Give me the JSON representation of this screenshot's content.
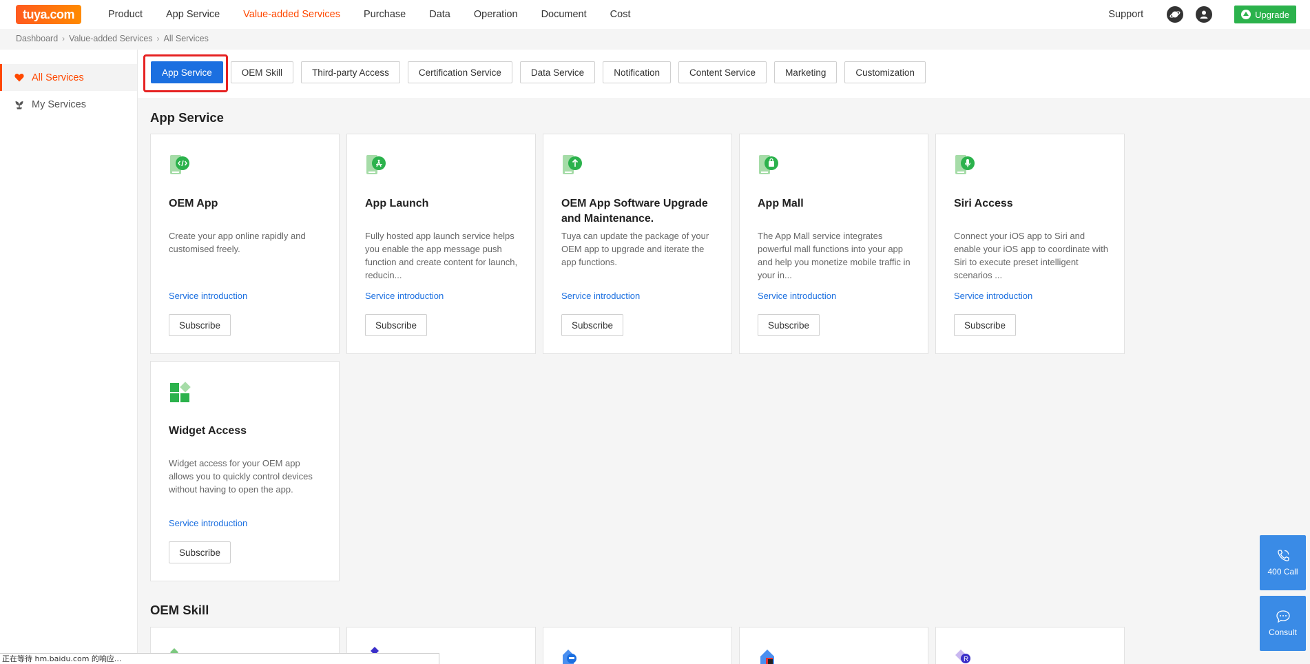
{
  "logo": {
    "text": "tuya.com"
  },
  "nav": {
    "items": [
      "Product",
      "App Service",
      "Value-added Services",
      "Purchase",
      "Data",
      "Operation",
      "Document",
      "Cost"
    ],
    "active_index": 2,
    "support": "Support",
    "upgrade": "Upgrade"
  },
  "breadcrumb": [
    "Dashboard",
    "Value-added Services",
    "All Services"
  ],
  "sidebar": {
    "items": [
      {
        "label": "All Services",
        "icon": "heart-icon"
      },
      {
        "label": "My Services",
        "icon": "plant-icon"
      }
    ]
  },
  "tabs": [
    "App Service",
    "OEM Skill",
    "Third-party Access",
    "Certification Service",
    "Data Service",
    "Notification",
    "Content Service",
    "Marketing",
    "Customization"
  ],
  "sections": [
    {
      "title": "App Service",
      "cards": [
        {
          "title": "OEM App",
          "desc": "Create your app online rapidly and customised freely.",
          "link": "Service introduction",
          "button": "Subscribe",
          "icon": "code-phone-icon"
        },
        {
          "title": "App Launch",
          "desc": "Fully hosted app launch service helps you enable the app message push function and create content for launch, reducin...",
          "link": "Service introduction",
          "button": "Subscribe",
          "icon": "app-store-phone-icon"
        },
        {
          "title": "OEM App Software Upgrade and Maintenance.",
          "desc": "Tuya can update the package of your OEM app to upgrade and iterate the app functions.",
          "link": "Service introduction",
          "button": "Subscribe",
          "icon": "upgrade-phone-icon"
        },
        {
          "title": "App Mall",
          "desc": "The App Mall service integrates powerful mall functions into your app and help you monetize mobile traffic in your in...",
          "link": "Service introduction",
          "button": "Subscribe",
          "icon": "mall-phone-icon"
        },
        {
          "title": "Siri Access",
          "desc": "Connect your iOS app to Siri and enable your iOS app to coordinate with Siri to execute preset intelligent scenarios ...",
          "link": "Service introduction",
          "button": "Subscribe",
          "icon": "microphone-phone-icon"
        },
        {
          "title": "Widget Access",
          "desc": "Widget access for your OEM app allows you to quickly control devices without having to open the app.",
          "link": "Service introduction",
          "button": "Subscribe",
          "icon": "widget-grid-icon"
        }
      ]
    },
    {
      "title": "OEM Skill"
    }
  ],
  "float": {
    "call": "400 Call",
    "consult": "Consult"
  },
  "status": "正在等待 hm.baidu.com 的响应...",
  "colors": {
    "accent": "#ff4800",
    "primary": "#1b6fe0",
    "green": "#2bb24c",
    "highlight": "#e62222"
  }
}
